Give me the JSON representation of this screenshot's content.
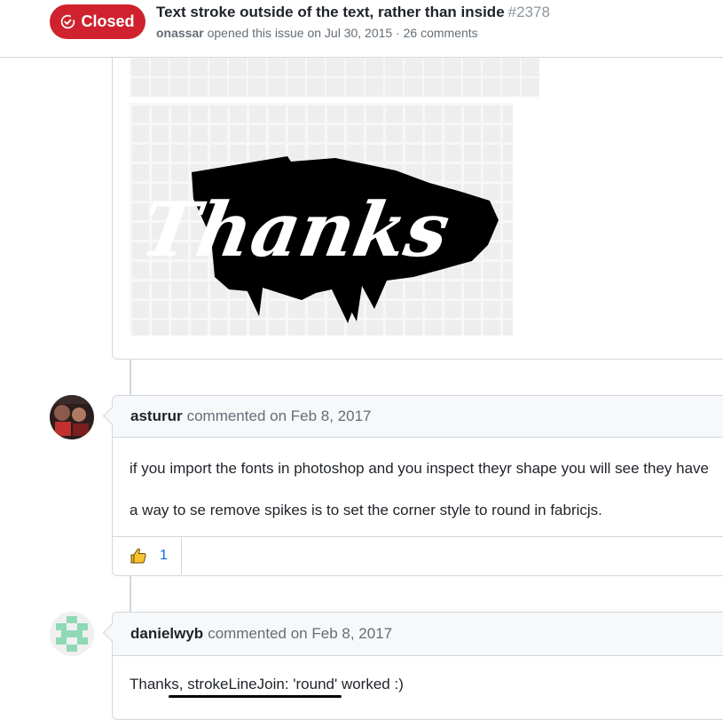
{
  "issue": {
    "state": "Closed",
    "title": "Text stroke outside of the text, rather than inside",
    "number": "#2378",
    "author": "onassar",
    "meta": "opened this issue on Jul 30, 2015 · 26 comments"
  },
  "image": {
    "lettering": "Thanks"
  },
  "comments": [
    {
      "author": "asturur",
      "action": "commented on Feb 8, 2017",
      "paragraphs": [
        "if you import the fonts in photoshop and you inspect theyr shape you will see they have",
        "a way to se remove spikes is to set the corner style to round in fabricjs."
      ],
      "reaction": {
        "emoji": "thumbs-up",
        "count": "1"
      }
    },
    {
      "author": "danielwyb",
      "action": "commented on Feb 8, 2017",
      "paragraphs": [
        "Thanks, strokeLineJoin: 'round' worked :)"
      ]
    }
  ],
  "colors": {
    "closed": "#cf222e",
    "link": "#0969da",
    "border": "#d0d7de",
    "header_bg": "#f6f8fa"
  }
}
